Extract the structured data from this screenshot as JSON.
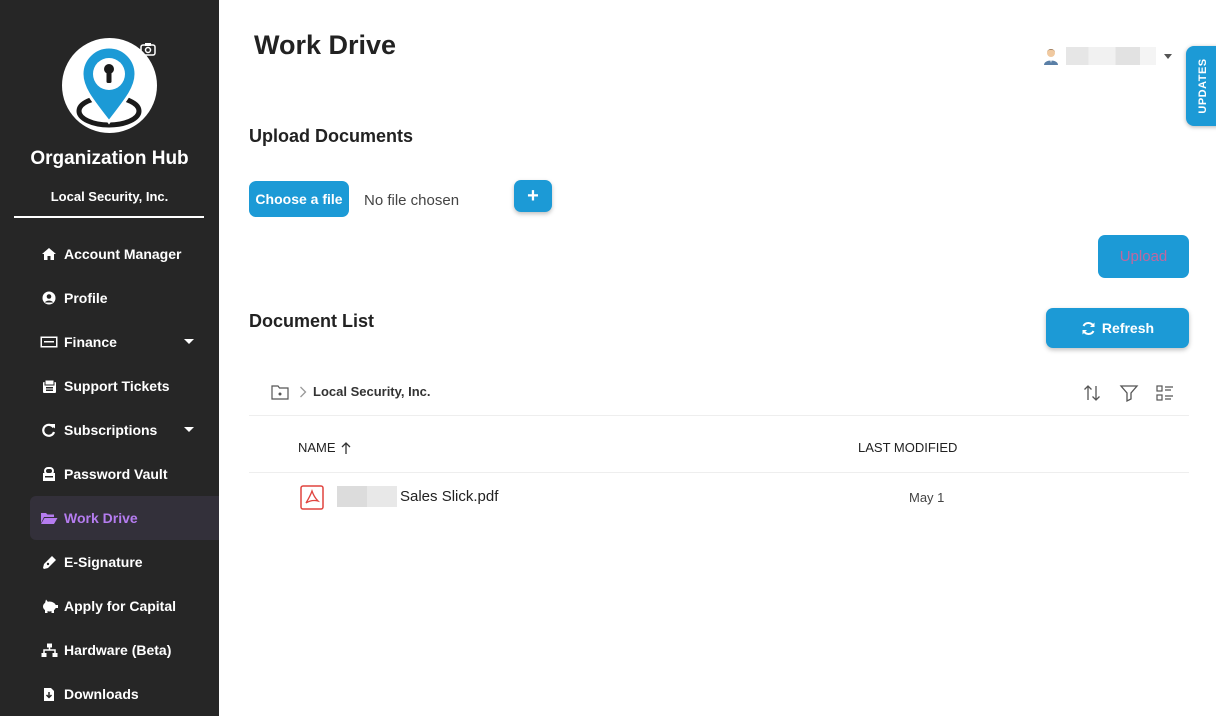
{
  "sidebar": {
    "org_title": "Organization Hub",
    "org_subtitle": "Local Security, Inc.",
    "items": [
      {
        "label": "Account Manager",
        "icon": "home-icon"
      },
      {
        "label": "Profile",
        "icon": "user-circle-icon"
      },
      {
        "label": "Finance",
        "icon": "money-icon",
        "has_caret": true
      },
      {
        "label": "Support Tickets",
        "icon": "ticket-icon"
      },
      {
        "label": "Subscriptions",
        "icon": "refresh-icon",
        "has_caret": true
      },
      {
        "label": "Password Vault",
        "icon": "vault-icon"
      },
      {
        "label": "Work Drive",
        "icon": "folder-open-icon",
        "active": true
      },
      {
        "label": "E-Signature",
        "icon": "pen-icon"
      },
      {
        "label": "Apply for Capital",
        "icon": "piggy-bank-icon"
      },
      {
        "label": "Hardware (Beta)",
        "icon": "network-icon"
      },
      {
        "label": "Downloads",
        "icon": "download-file-icon"
      }
    ]
  },
  "header": {
    "title": "Work Drive",
    "updates_tab": "UPDATES"
  },
  "upload": {
    "section_title": "Upload Documents",
    "choose_label": "Choose a file",
    "no_file_text": "No file chosen",
    "add_label": "+",
    "upload_label": "Upload"
  },
  "documents": {
    "section_title": "Document List",
    "refresh_label": "Refresh",
    "breadcrumb": "Local Security, Inc.",
    "columns": {
      "name": "NAME",
      "modified": "LAST MODIFIED"
    },
    "rows": [
      {
        "name": "Sales Slick.pdf",
        "modified": "May 1"
      }
    ]
  },
  "colors": {
    "accent": "#1c9ad6",
    "sidebar_bg": "#262626",
    "active_text": "#b57cf0",
    "pdf_red": "#e0443f"
  }
}
